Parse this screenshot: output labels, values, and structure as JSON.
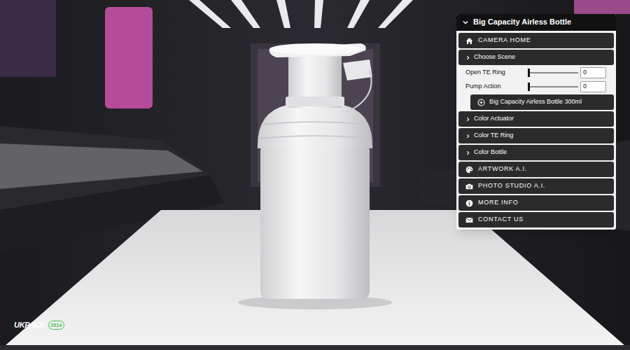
{
  "viewer": {
    "logo": {
      "brand": "UKPACK",
      "year": "2014"
    }
  },
  "panel": {
    "title": "Big Capacity Airless Bottle",
    "expanded": true,
    "items": [
      {
        "kind": "button",
        "label": "CAMERA HOME"
      },
      {
        "kind": "folder",
        "label": "Choose Scene",
        "expanded": false
      },
      {
        "kind": "slider",
        "label": "Open TE Ring",
        "level": 0,
        "value": "0"
      },
      {
        "kind": "slider",
        "label": "Pump Action",
        "level": 0,
        "value": "0"
      },
      {
        "kind": "action",
        "label": "Big Capacity Airless Bottle 300ml"
      },
      {
        "kind": "folder",
        "label": "Color Actuator",
        "expanded": false
      },
      {
        "kind": "folder",
        "label": "Color TE Ring",
        "expanded": false
      },
      {
        "kind": "folder",
        "label": "Color Bottle",
        "expanded": false
      },
      {
        "kind": "button",
        "label": "ARTWORK A.I."
      },
      {
        "kind": "button",
        "label": "PHOTO STUDIO A.I."
      },
      {
        "kind": "button",
        "label": "MORE INFO"
      },
      {
        "kind": "button",
        "label": "CONTACT US"
      }
    ]
  }
}
